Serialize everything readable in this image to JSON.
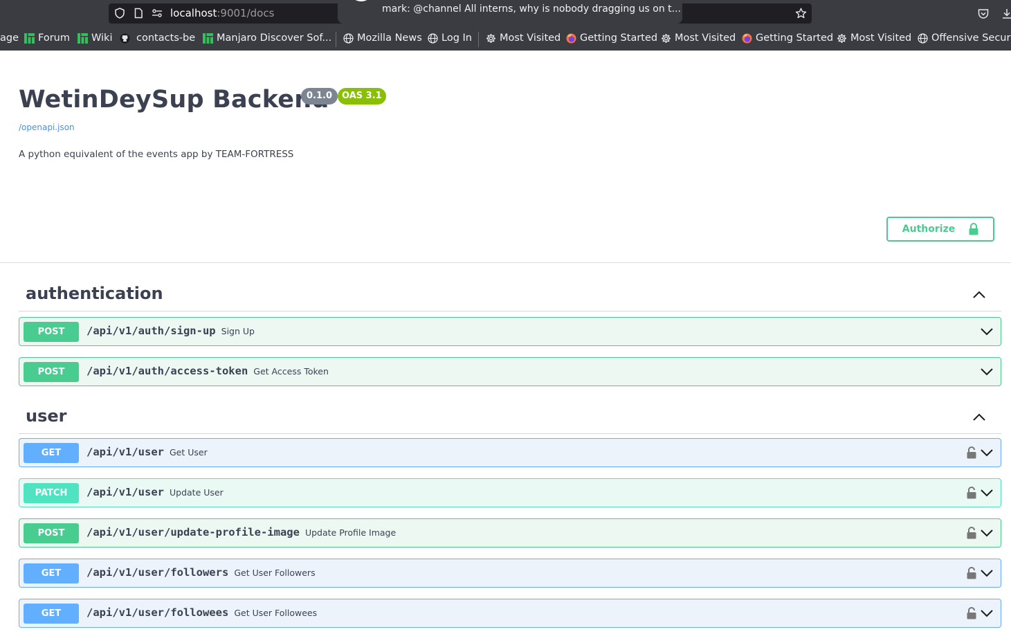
{
  "browser": {
    "url_host": "localhost",
    "url_rest": ":9001/docs",
    "notification": "mark: @channel All interns, why is nobody dragging us on t...",
    "bookmarks": [
      "age",
      "Forum",
      "Wiki",
      "contacts-be",
      "Manjaro Discover Sof...",
      "Mozilla News",
      "Log In",
      "Most Visited",
      "Getting Started",
      "Most Visited",
      "Getting Started",
      "Most Visited",
      "Offensive Securit"
    ]
  },
  "info": {
    "title": "WetinDeySup Backend",
    "version": "0.1.0",
    "oas": "OAS 3.1",
    "spec_link": "/openapi.json",
    "description": "A python equivalent of the events app by TEAM-FORTRESS"
  },
  "authorize": {
    "label": "Authorize"
  },
  "tags": [
    {
      "name": "authentication",
      "operations": [
        {
          "method": "POST",
          "path": "/api/v1/auth/sign-up",
          "summary": "Sign Up"
        },
        {
          "method": "POST",
          "path": "/api/v1/auth/access-token",
          "summary": "Get Access Token"
        }
      ]
    },
    {
      "name": "user",
      "operations": [
        {
          "method": "GET",
          "path": "/api/v1/user",
          "summary": "Get User"
        },
        {
          "method": "PATCH",
          "path": "/api/v1/user",
          "summary": "Update User"
        },
        {
          "method": "POST",
          "path": "/api/v1/user/update-profile-image",
          "summary": "Update Profile Image"
        },
        {
          "method": "GET",
          "path": "/api/v1/user/followers",
          "summary": "Get User Followers"
        },
        {
          "method": "GET",
          "path": "/api/v1/user/followees",
          "summary": "Get User Followees"
        }
      ]
    }
  ],
  "colors": {
    "post": "#49cc90",
    "get": "#61affe",
    "patch": "#50e3c2",
    "title": "#3b4151",
    "oas_badge": "#89bf04"
  }
}
